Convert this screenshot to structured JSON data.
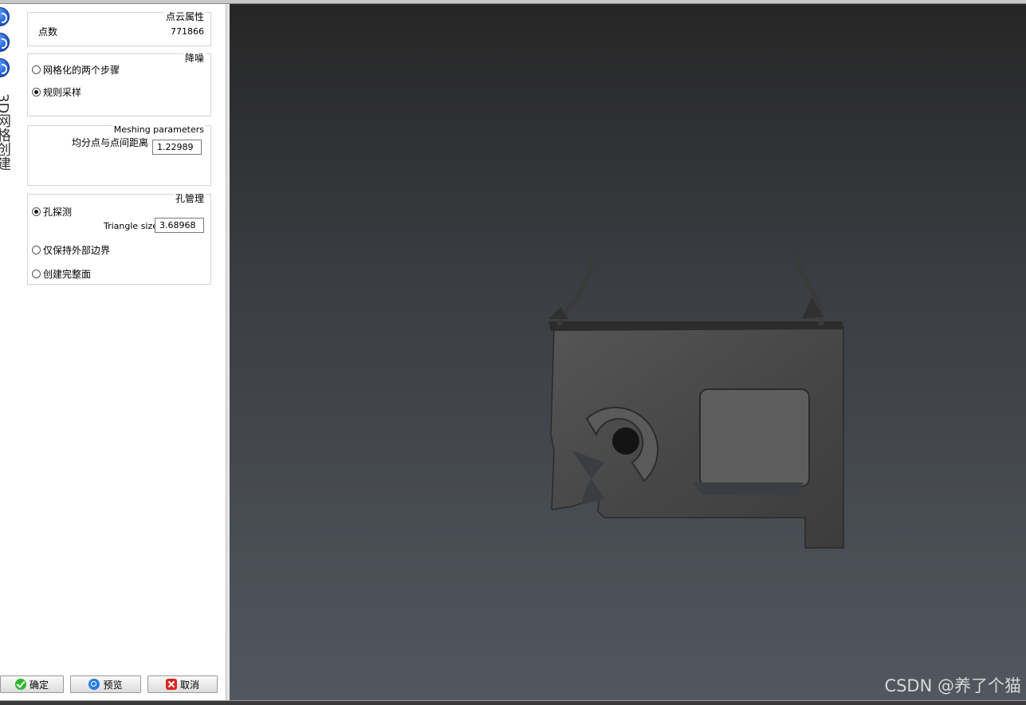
{
  "side": {
    "title": "3D网格创建"
  },
  "pointcloud": {
    "title": "点云属性",
    "count_label": "点数",
    "count_value": "771866"
  },
  "denoise": {
    "title": "降噪",
    "options": [
      {
        "label": "网格化的两个步骤",
        "selected": false
      },
      {
        "label": "规则采样",
        "selected": true
      }
    ]
  },
  "meshing": {
    "title": "Meshing parameters",
    "distance_label": "均分点与点间距离",
    "distance_value": "1.22989"
  },
  "holes": {
    "title": "孔管理",
    "options": [
      {
        "label": "孔探测",
        "selected": true
      },
      {
        "label": "仅保持外部边界",
        "selected": false
      },
      {
        "label": "创建完整面",
        "selected": false
      }
    ],
    "triangle_label": "Triangle size",
    "triangle_value": "3.68968"
  },
  "buttons": {
    "ok": "确定",
    "preview": "预览",
    "cancel": "取消"
  },
  "watermark": "CSDN @养了个猫",
  "colors": {
    "model": "#4a4a4a",
    "viewport_top": "#262626",
    "viewport_bottom": "#52575f",
    "accent": "#1f5fd6"
  }
}
